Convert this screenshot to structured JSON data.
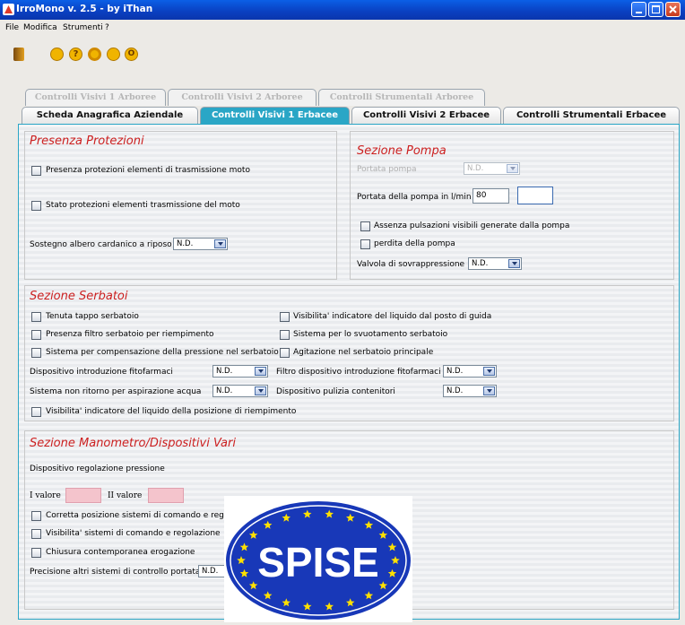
{
  "window": {
    "title": "IrroMono v. 2.5 - by iThan"
  },
  "menu": [
    "File",
    "Modifica",
    "Strumenti",
    "?"
  ],
  "tabs_upper": [
    "Controlli Visivi 1 Arboree",
    "Controlli Visivi 2 Arboree",
    "Controlli Strumentali Arboree"
  ],
  "tabs_lower": [
    "Scheda Anagrafica Aziendale",
    "Controlli Visivi 1 Erbacee",
    "Controlli Visivi 2 Erbacee",
    "Controlli Strumentali Erbacee"
  ],
  "presenza": {
    "title": "Presenza Protezioni",
    "cb1": "Presenza protezioni elementi di trasmissione moto",
    "cb2": "Stato protezioni elementi trasmissione del moto",
    "sostegno_label": "Sostegno albero cardanico a riposo",
    "sostegno_value": "N.D."
  },
  "pompa": {
    "title": "Sezione Pompa",
    "portata_label": "Portata pompa",
    "portata_value": "N.D.",
    "portata_lmin_label": "Portata della pompa in l/min",
    "portata_lmin_value": "80",
    "portata_lmin_value2": "",
    "cb1": "Assenza pulsazioni visibili generate dalla pompa",
    "cb2": "perdita della pompa",
    "valvola_label": "Valvola di sovrappressione",
    "valvola_value": "N.D."
  },
  "serbatoi": {
    "title": "Sezione Serbatoi",
    "cb_left": [
      "Tenuta tappo serbatoio",
      "Presenza filtro serbatoio per riempimento",
      "Sistema per compensazione della pressione nel serbatoio"
    ],
    "cb_right": [
      "Visibilita' indicatore del liquido dal posto di guida",
      "Sistema per lo svuotamento serbatoio",
      "Agitazione nel serbatoio principale"
    ],
    "disp_intro_label": "Dispositivo introduzione fitofarmaci",
    "disp_intro_value": "N.D.",
    "filtro_label": "Filtro dispositivo introduzione fitofarmaci",
    "filtro_value": "N.D.",
    "non_ritorno_label": "Sistema non ritorno per aspirazione acqua",
    "non_ritorno_value": "N.D.",
    "pulizia_label": "Dispositivo pulizia contenitori",
    "pulizia_value": "N.D.",
    "cb_bottom": "Visibilita' indicatore del liquido della posizione di riempimento"
  },
  "manometro": {
    "title": "Sezione Manometro/Dispositivi Vari",
    "reg_label": "Dispositivo regolazione pressione",
    "i_valore": "I valore",
    "ii_valore": "II valore",
    "cb": [
      "Corretta posizione sistemi di comando e regol",
      "Visibilita' sistemi di comando e regolazione",
      "Chiusura contemporanea erogazione"
    ],
    "precisione_label": "Precisione altri sistemi di controllo portata",
    "precisione_value": "N.D."
  },
  "logo": {
    "text": "SPISE"
  },
  "colors": {
    "accent": "#2aa6c6",
    "section_title": "#cc2020",
    "title_bar": "#0a3fc0",
    "logo_blue": "#1838b8",
    "logo_stars": "#ffe000"
  }
}
